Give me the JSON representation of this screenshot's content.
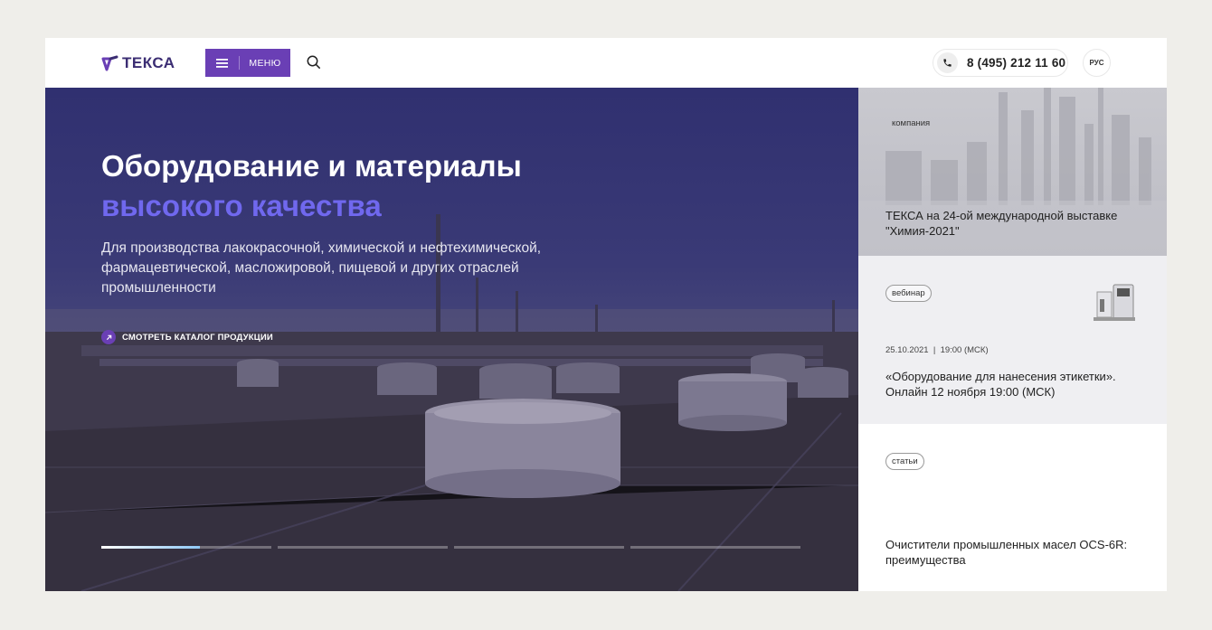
{
  "brand": {
    "logo_text": "ТЕКСА",
    "accent": "#6a3fb5",
    "title_accent": "#7068ee"
  },
  "header": {
    "menu_label": "МЕНЮ",
    "menu_icon": "hamburger-icon",
    "search_icon": "search-icon",
    "phone_icon": "phone-icon",
    "phone": "8 (495) 212 11 60",
    "lang": "РУС"
  },
  "hero": {
    "title_line1": "Оборудование и материалы",
    "title_line2": "высокого качества",
    "description": "Для производства лакокрасочной, химической и нефтехимической, фармацевтической, масложировой, пищевой и других отраслей промышленности",
    "cta": "СМОТРЕТЬ КАТАЛОГ ПРОДУКЦИИ",
    "cta_icon": "arrow-up-right-icon",
    "slides_total": 4,
    "active_slide": 1,
    "active_slide_progress": 0.58
  },
  "news": [
    {
      "tag": "компания",
      "title": "ТЕКСА на 24-ой международной выставке \"Химия-2021\""
    },
    {
      "tag": "вебинар",
      "date": "25.10.2021  |  19:00 (МСК)",
      "title": "«Оборудование для нанесения этикетки». Онлайн 12 ноября 19:00 (МСК)"
    },
    {
      "tag": "статьи",
      "title": "Очистители промышленных масел OCS-6R: преимущества"
    }
  ]
}
